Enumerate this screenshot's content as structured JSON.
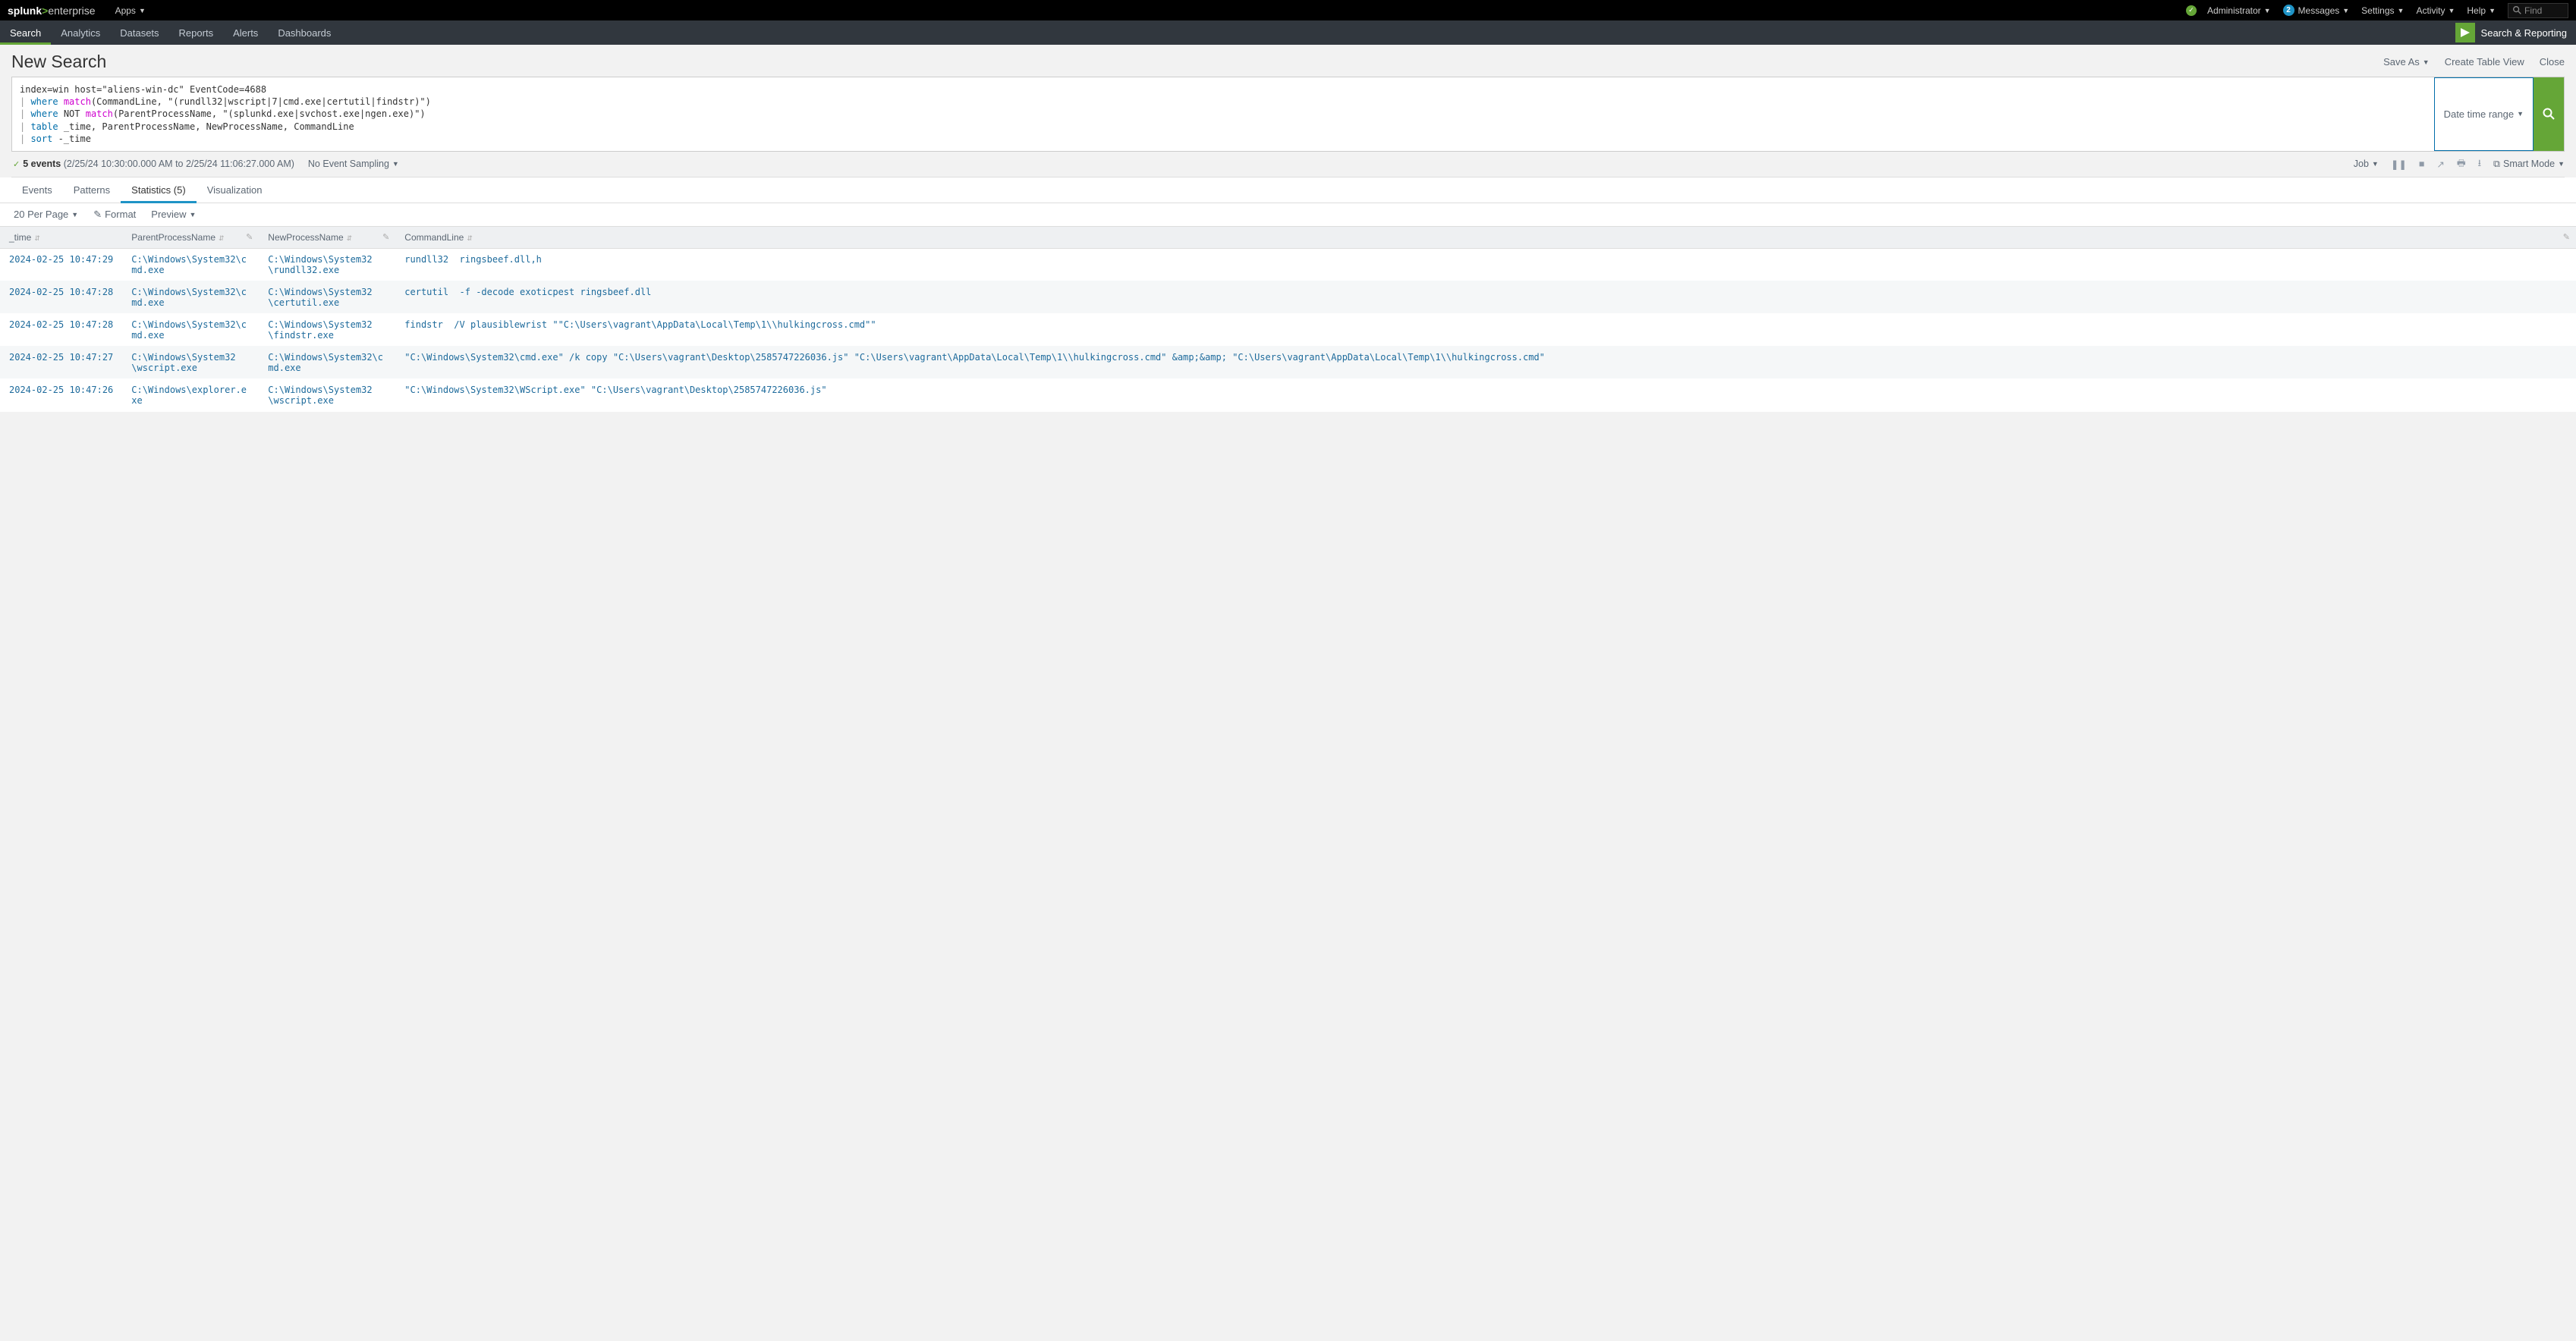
{
  "topbar": {
    "logo_brand": "splunk",
    "logo_sep": ">",
    "logo_prod": "enterprise",
    "apps": "Apps",
    "user": "Administrator",
    "messages_count": "2",
    "messages": "Messages",
    "settings": "Settings",
    "activity": "Activity",
    "help": "Help",
    "find": "Find"
  },
  "nav": {
    "items": [
      "Search",
      "Analytics",
      "Datasets",
      "Reports",
      "Alerts",
      "Dashboards"
    ],
    "active": 0,
    "app_label": "Search & Reporting"
  },
  "page": {
    "title": "New Search",
    "actions": {
      "save_as": "Save As",
      "create_table": "Create Table View",
      "close": "Close"
    }
  },
  "search": {
    "timerange": "Date time range",
    "tokens": [
      {
        "t": "plain",
        "v": "index=win host=\"aliens-win-dc\" EventCode=4688"
      },
      {
        "t": "nl"
      },
      {
        "t": "pipe",
        "v": "| "
      },
      {
        "t": "blue",
        "v": "where "
      },
      {
        "t": "pink",
        "v": "match"
      },
      {
        "t": "plain",
        "v": "(CommandLine, \"(rundll32|wscript|7|cmd.exe|certutil|findstr)\")"
      },
      {
        "t": "nl"
      },
      {
        "t": "pipe",
        "v": "| "
      },
      {
        "t": "blue",
        "v": "where "
      },
      {
        "t": "plain",
        "v": "NOT "
      },
      {
        "t": "pink",
        "v": "match"
      },
      {
        "t": "plain",
        "v": "(ParentProcessName, \"(splunkd.exe|svchost.exe|ngen.exe)\")"
      },
      {
        "t": "nl"
      },
      {
        "t": "pipe",
        "v": "| "
      },
      {
        "t": "blue",
        "v": "table "
      },
      {
        "t": "plain",
        "v": "_time, ParentProcessName, NewProcessName, CommandLine"
      },
      {
        "t": "nl"
      },
      {
        "t": "pipe",
        "v": "| "
      },
      {
        "t": "blue",
        "v": "sort "
      },
      {
        "t": "plain",
        "v": "-_time"
      }
    ]
  },
  "status": {
    "count": "5 events",
    "range": "(2/25/24 10:30:00.000 AM to 2/25/24 11:06:27.000 AM)",
    "sampling": "No Event Sampling",
    "job": "Job",
    "smart": "Smart Mode"
  },
  "tabs": {
    "items": [
      "Events",
      "Patterns",
      "Statistics (5)",
      "Visualization"
    ],
    "active": 2
  },
  "toolbar": {
    "per_page": "20 Per Page",
    "format": "Format",
    "preview": "Preview"
  },
  "table": {
    "headers": [
      "_time",
      "ParentProcessName",
      "NewProcessName",
      "CommandLine"
    ],
    "rows": [
      {
        "time": "2024-02-25 10:47:29",
        "pp": "C:\\Windows\\System32\\cmd.exe",
        "np": "C:\\Windows\\System32\n\\rundll32.exe",
        "cmd": "rundll32  ringsbeef.dll,h"
      },
      {
        "time": "2024-02-25 10:47:28",
        "pp": "C:\\Windows\\System32\\cmd.exe",
        "np": "C:\\Windows\\System32\n\\certutil.exe",
        "cmd": "certutil  -f -decode exoticpest ringsbeef.dll"
      },
      {
        "time": "2024-02-25 10:47:28",
        "pp": "C:\\Windows\\System32\\cmd.exe",
        "np": "C:\\Windows\\System32\n\\findstr.exe",
        "cmd": "findstr  /V plausiblewrist \"\"C:\\Users\\vagrant\\AppData\\Local\\Temp\\1\\\\hulkingcross.cmd\"\""
      },
      {
        "time": "2024-02-25 10:47:27",
        "pp": "C:\\Windows\\System32\n\\wscript.exe",
        "np": "C:\\Windows\\System32\\cmd.exe",
        "cmd": "\"C:\\Windows\\System32\\cmd.exe\" /k copy \"C:\\Users\\vagrant\\Desktop\\2585747226036.js\" \"C:\\Users\\vagrant\\AppData\\Local\\Temp\\1\\\\hulkingcross.cmd\" &amp;&amp; \"C:\\Users\\vagrant\\AppData\\Local\\Temp\\1\\\\hulkingcross.cmd\""
      },
      {
        "time": "2024-02-25 10:47:26",
        "pp": "C:\\Windows\\explorer.exe",
        "np": "C:\\Windows\\System32\n\\wscript.exe",
        "cmd": "\"C:\\Windows\\System32\\WScript.exe\" \"C:\\Users\\vagrant\\Desktop\\2585747226036.js\""
      }
    ]
  }
}
